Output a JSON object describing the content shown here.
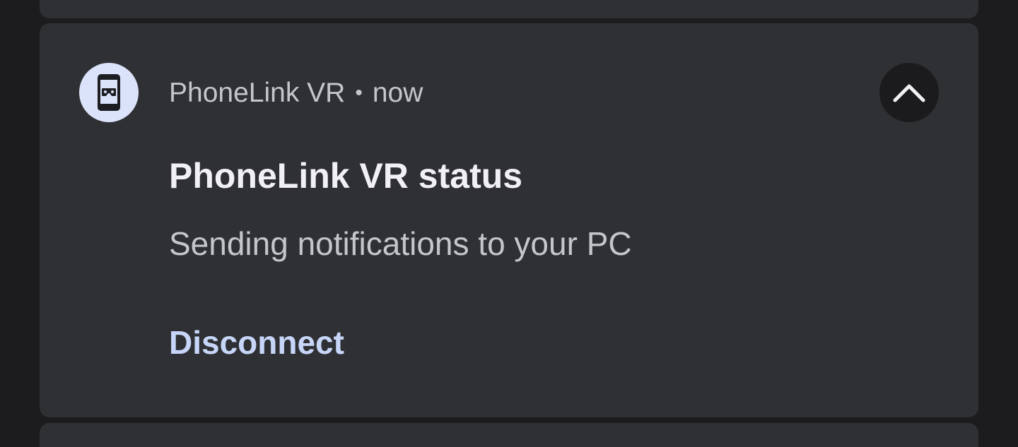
{
  "notification": {
    "app_name": "PhoneLink VR",
    "separator": "•",
    "time": "now",
    "title": "PhoneLink VR status",
    "body": "Sending notifications to your PC",
    "action_label": "Disconnect",
    "app_icon": "phone-vr-icon",
    "expand_icon": "chevron-up-icon"
  },
  "colors": {
    "background": "#1c1c1e",
    "card": "#2f3034",
    "icon_circle": "#dbe3fa",
    "action_text": "#c7d6f8",
    "expand_button": "#1b1b1d"
  }
}
